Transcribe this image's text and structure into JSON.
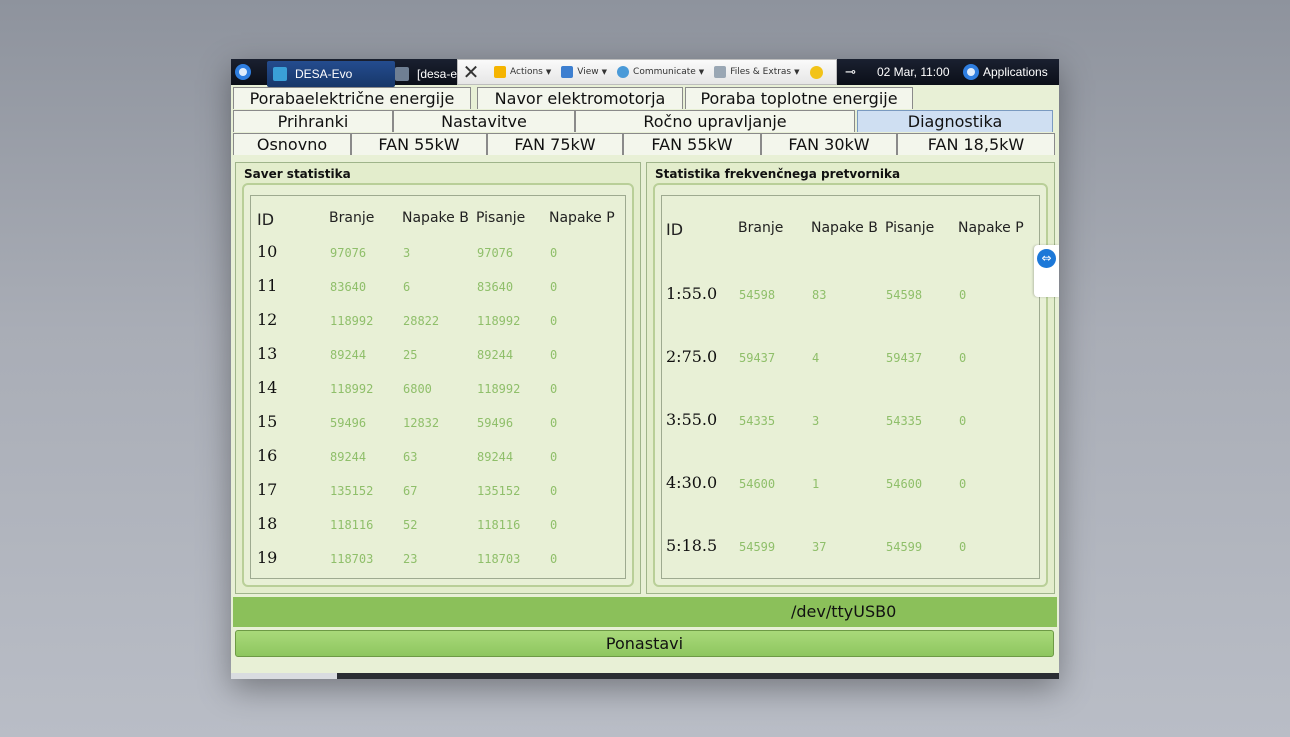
{
  "panel": {
    "task_active": "DESA-Evo",
    "task_inactive": "[desa-e",
    "date": "02 Mar, 11:00",
    "applications": "Applications"
  },
  "teamviewer": {
    "actions": "Actions",
    "view": "View",
    "communicate": "Communicate",
    "files": "Files & Extras"
  },
  "tabs": {
    "row1": [
      "Porabaelektrične energije",
      "Navor elektromotorja",
      "Poraba toplotne energije"
    ],
    "row2": [
      "Prihranki",
      "Nastavitve",
      "Ročno upravljanje",
      "Diagnostika"
    ],
    "row3": [
      "Osnovno",
      "FAN 55kW",
      "FAN 75kW",
      "FAN 55kW",
      "FAN 30kW",
      "FAN 18,5kW"
    ]
  },
  "saver": {
    "title": "Saver statistika",
    "headers": [
      "ID",
      "Branje",
      "Napake B",
      "Pisanje",
      "Napake P"
    ],
    "rows": [
      [
        "10",
        "97076",
        "3",
        "97076",
        "0"
      ],
      [
        "11",
        "83640",
        "6",
        "83640",
        "0"
      ],
      [
        "12",
        "118992",
        "28822",
        "118992",
        "0"
      ],
      [
        "13",
        "89244",
        "25",
        "89244",
        "0"
      ],
      [
        "14",
        "118992",
        "6800",
        "118992",
        "0"
      ],
      [
        "15",
        "59496",
        "12832",
        "59496",
        "0"
      ],
      [
        "16",
        "89244",
        "63",
        "89244",
        "0"
      ],
      [
        "17",
        "135152",
        "67",
        "135152",
        "0"
      ],
      [
        "18",
        "118116",
        "52",
        "118116",
        "0"
      ],
      [
        "19",
        "118703",
        "23",
        "118703",
        "0"
      ]
    ]
  },
  "inverter": {
    "title": "Statistika frekvenčnega pretvornika",
    "headers": [
      "ID",
      "Branje",
      "Napake B",
      "Pisanje",
      "Napake P"
    ],
    "rows": [
      [
        "1:55.0",
        "54598",
        "83",
        "54598",
        "0"
      ],
      [
        "2:75.0",
        "59437",
        "4",
        "59437",
        "0"
      ],
      [
        "3:55.0",
        "54335",
        "3",
        "54335",
        "0"
      ],
      [
        "4:30.0",
        "54600",
        "1",
        "54600",
        "0"
      ],
      [
        "5:18.5",
        "54599",
        "37",
        "54599",
        "0"
      ]
    ]
  },
  "status": {
    "port": "/dev/ttyUSB0"
  },
  "reset": {
    "label": "Ponastavi"
  },
  "colors": {
    "value_green": "#8fbf6a",
    "status_green": "#8bc05a",
    "active_tab": "#cfdff2"
  }
}
